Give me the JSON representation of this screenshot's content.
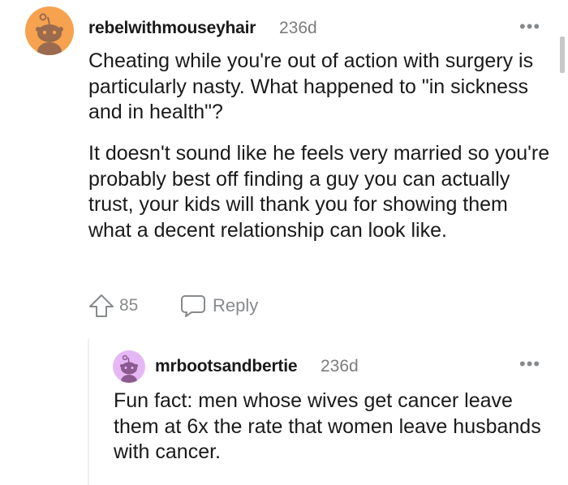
{
  "comment": {
    "username": "rebelwithmouseyhair",
    "age": "236d",
    "paragraphs": [
      "Cheating while you're out of action with surgery is particularly nasty. What happened to \"in sickness and in health\"?",
      "It doesn't sound like he feels very married so you're probably best off finding a guy you can actually trust, your kids will thank you for showing them what a decent relationship can look like."
    ],
    "votes": "85",
    "reply_label": "Reply",
    "more_label": "•••",
    "avatar_color": "#f7a24f"
  },
  "reply": {
    "username": "mrbootsandbertie",
    "age": "236d",
    "text": "Fun fact: men whose wives get cancer leave them at 6x the rate that women leave husbands with cancer.",
    "more_label": "•••",
    "avatar_color": "#e5b8f5"
  },
  "icons": {
    "upvote": "upvote-icon",
    "reply": "speech-bubble-icon",
    "avatar": "reddit-snoo-icon",
    "more": "more-options-icon"
  }
}
